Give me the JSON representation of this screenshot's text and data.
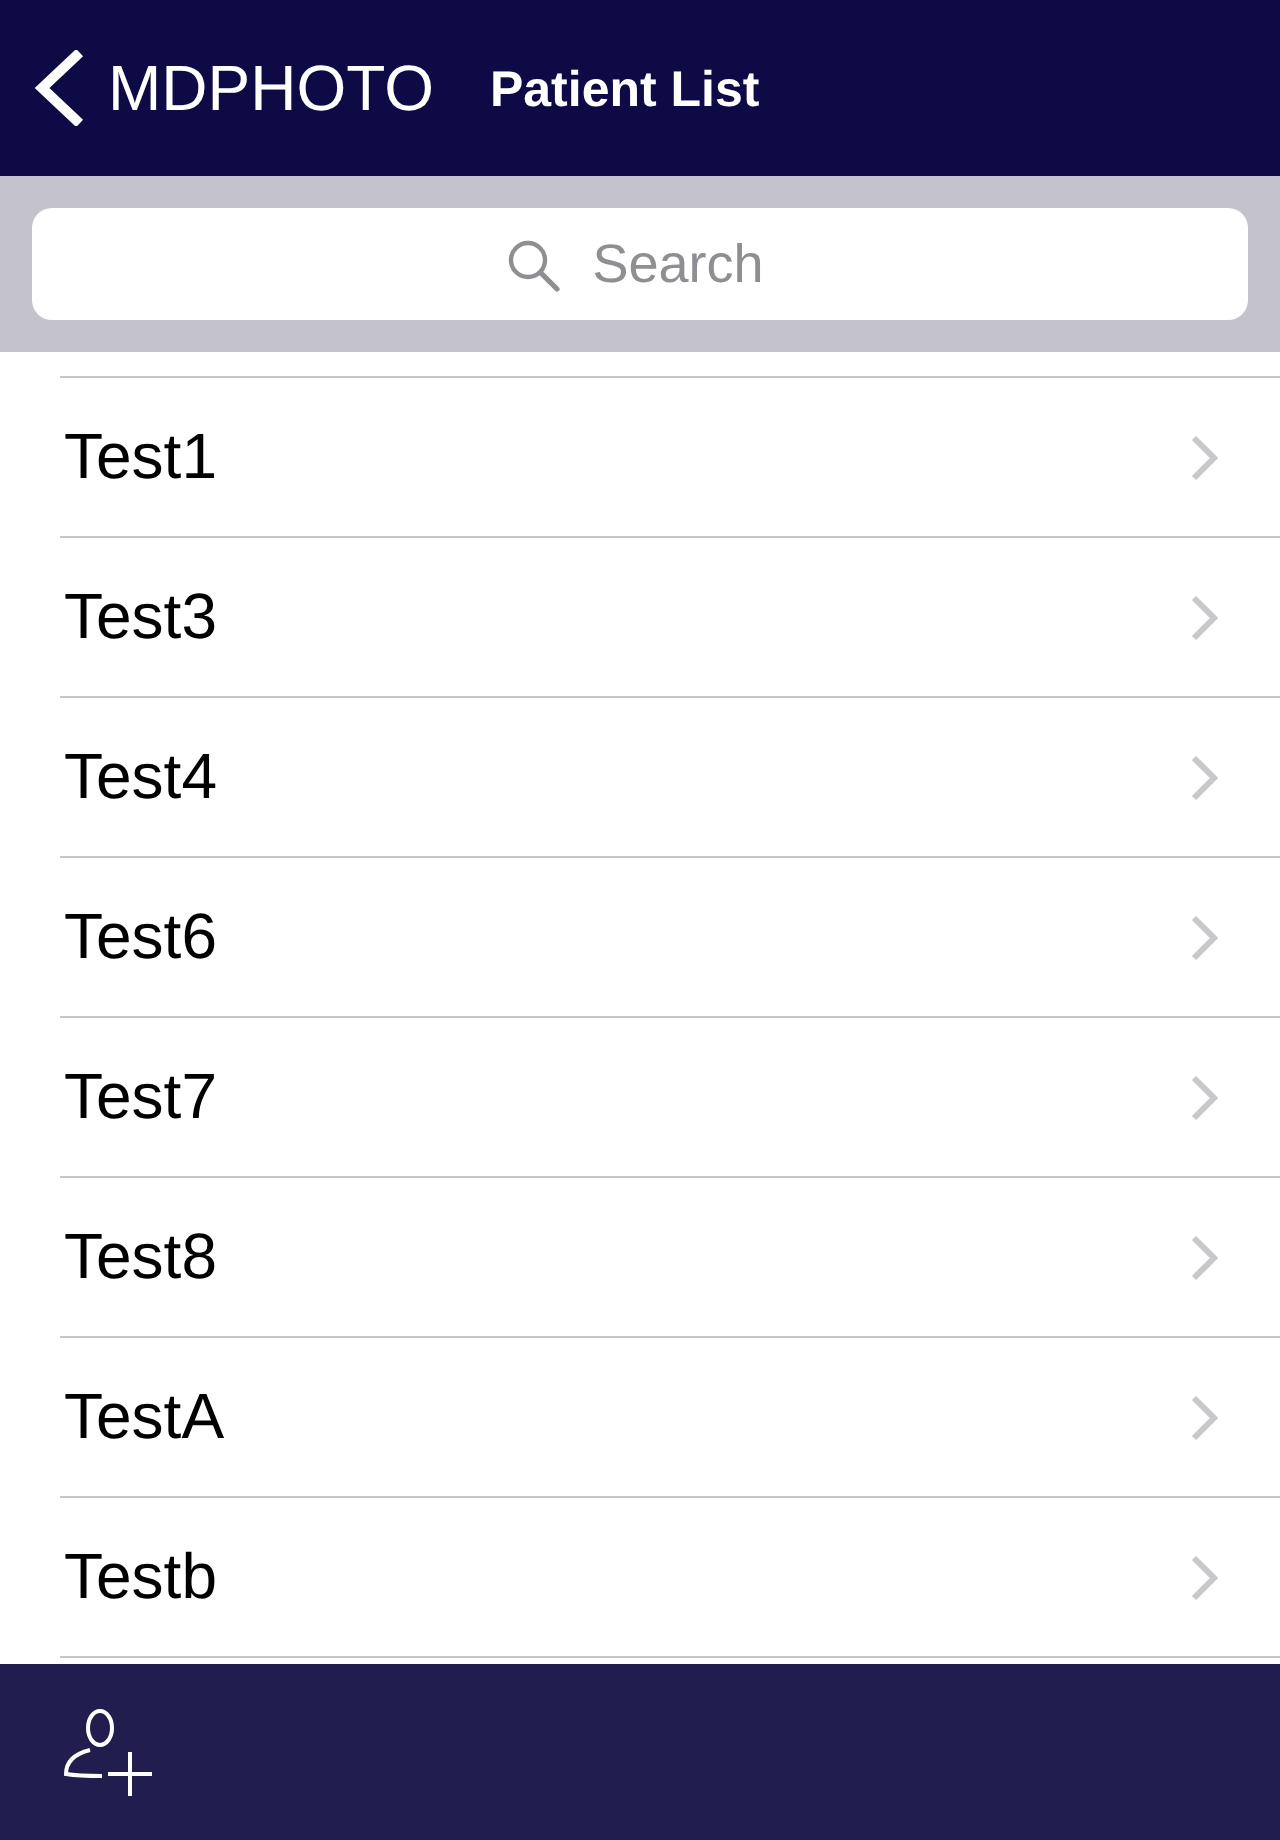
{
  "nav_bar": {
    "back_label": "MDPHOTO",
    "title": "Patient List"
  },
  "search": {
    "placeholder": "Search"
  },
  "patients": [
    {
      "name": "Test1"
    },
    {
      "name": "Test3"
    },
    {
      "name": "Test4"
    },
    {
      "name": "Test6"
    },
    {
      "name": "Test7"
    },
    {
      "name": "Test8"
    },
    {
      "name": "TestA"
    },
    {
      "name": "Testb"
    }
  ]
}
